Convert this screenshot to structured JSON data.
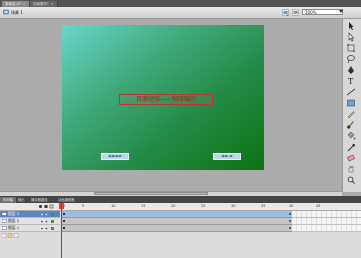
{
  "tabs": {
    "doc1": "未命名-1*",
    "doc2": "场景素材*"
  },
  "editbar": {
    "scene_label": "场景 1",
    "zoom_value": "100%"
  },
  "stage": {
    "title_text": "百度经验——咖啡味的",
    "button_left_label": "▬▬▬▬",
    "button_right_label": "▬▬ ▬"
  },
  "panel_tabs": [
    "时间轴",
    "输出",
    "编译器错误",
    "动画编辑器"
  ],
  "timeline": {
    "frame_numbers": [
      "1",
      "5",
      "10",
      "15",
      "20",
      "25",
      "30",
      "35",
      "40",
      "45"
    ],
    "layers": [
      {
        "name": "图层 3",
        "selected": true
      },
      {
        "name": "图层 2",
        "selected": false
      },
      {
        "name": "图层 1",
        "selected": false
      }
    ]
  },
  "colors": {
    "stage_gradient_start": "#6ad6c9",
    "stage_gradient_end": "#0d7212",
    "title_text_color": "#b01818",
    "selected_layer": "#5b86c4",
    "playhead": "#e02020"
  }
}
